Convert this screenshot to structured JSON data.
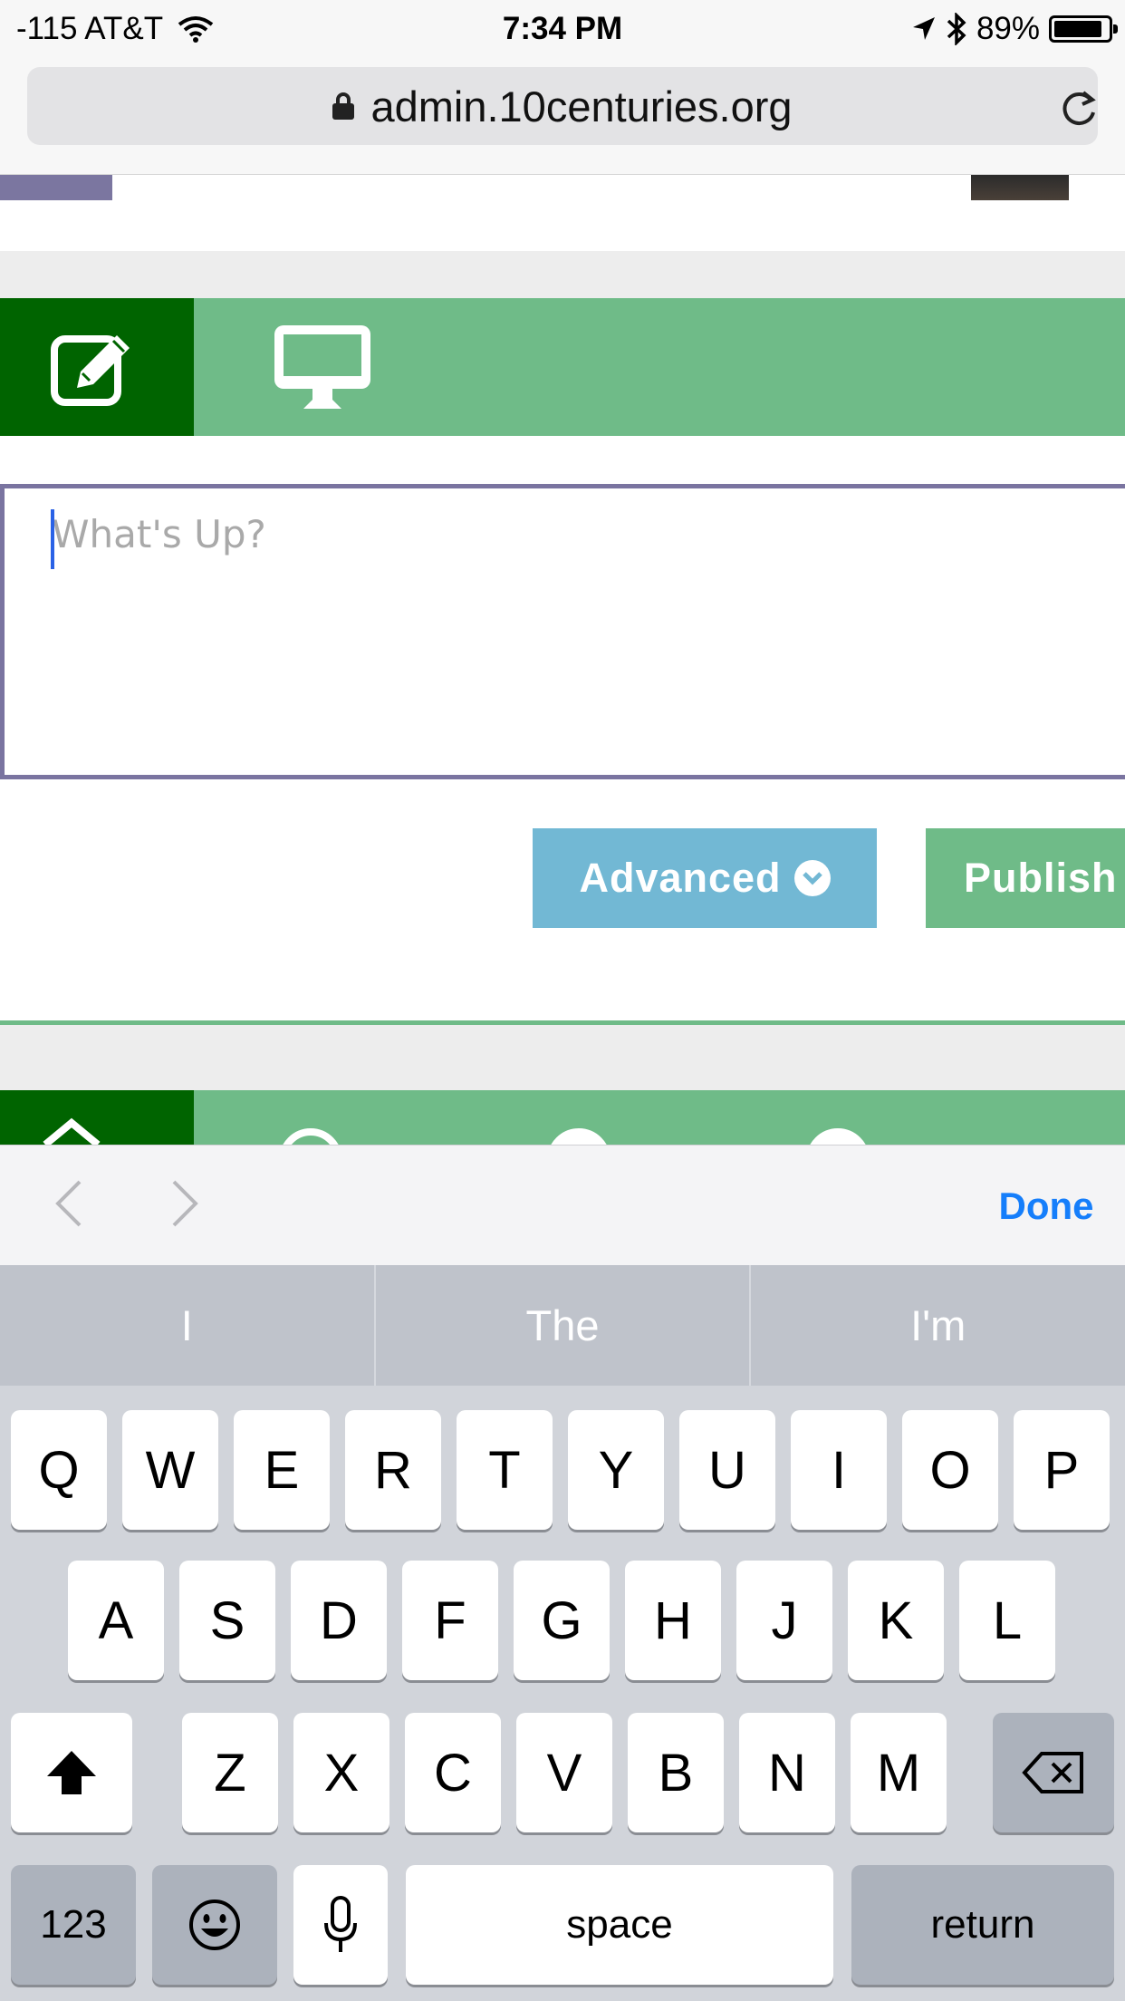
{
  "status_bar": {
    "carrier": "-115 AT&T",
    "time": "7:34 PM",
    "battery": "89%",
    "battery_level": 0.89,
    "icons": [
      "wifi-icon",
      "location-arrow-icon",
      "bluetooth-icon",
      "battery-icon"
    ]
  },
  "browser": {
    "url": "admin.10centuries.org",
    "icons": [
      "lock-icon",
      "reload-icon"
    ]
  },
  "page": {
    "colors": {
      "primary_green": "#6fbb88",
      "dark_green": "#006400",
      "editor_border": "#7a74a0",
      "advanced_blue": "#72b8d4"
    },
    "toolbar_icons": [
      "edit-icon",
      "desktop-icon"
    ],
    "editor_placeholder": "What's Up?",
    "advanced_label": "Advanced",
    "publish_label": "Publish"
  },
  "keyboard_accessory": {
    "done_label": "Done"
  },
  "keyboard": {
    "suggestions": [
      "I",
      "The",
      "I'm"
    ],
    "row1": [
      "Q",
      "W",
      "E",
      "R",
      "T",
      "Y",
      "U",
      "I",
      "O",
      "P"
    ],
    "row2": [
      "A",
      "S",
      "D",
      "F",
      "G",
      "H",
      "J",
      "K",
      "L"
    ],
    "row3": [
      "Z",
      "X",
      "C",
      "V",
      "B",
      "N",
      "M"
    ],
    "numbers_label": "123",
    "space_label": "space",
    "return_label": "return"
  }
}
